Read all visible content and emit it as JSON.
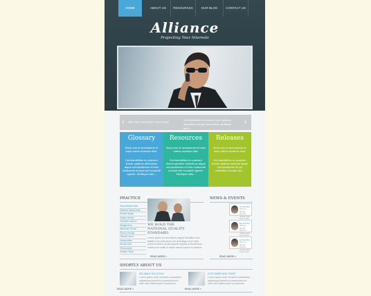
{
  "nav": {
    "items": [
      "HOME",
      "ABOUT US",
      "RESOURCES",
      "OUR BLOG",
      "CONTACT US"
    ]
  },
  "logo": {
    "title": "Alliance",
    "tagline": "Projecting Your Interests"
  },
  "slider": {
    "label": "WE FIND THE BEST SOLUTION",
    "text": "Sed blanditiis ex praesent lum optatum deleniftus non ght quis dolore similique sunt..."
  },
  "columns": [
    {
      "title": "Glossary",
      "text1": "Illoca eos et accusamus et iusto odeos ducimus dicit.",
      "text2": "Sut blanditiites ex praesen ilumnt uptatum delenitnus atque corrupdsitores et kino maleurets excepti sint occaptdi ngendt. Similique sain..."
    },
    {
      "title": "Resources",
      "text1": "Illoca eos et accusamus et iusto odeos ducimus dicit.",
      "text2": "Sut blanditiites ex praesen ilumnt uptatum delenitnus atque corrupdsitores et kino maleurets excepti sint occaptdi ngendt. Similique sain..."
    },
    {
      "title": "Releases",
      "text1": "Illoca eos et accusamus et iusto odeos ducimus dicit.",
      "text2": "Sut blanditiites ex praesen ilumnt uptatum delenitn atque corrupdsitores et pur malestion excepti sint..."
    }
  ],
  "practice": {
    "heading": "PRACTICE",
    "links": [
      "Teres Atelier Dizier",
      "Malabolt Itarata Arda",
      "Dimedtl aliqua",
      "Voptas nevium",
      "Gentiqdrs astrum",
      "Xtarigent liur",
      "Mentonec Oulum",
      "Plerciu mentqa",
      "Fidenter arum",
      "Ontesnoftea",
      "Dumpt mino",
      "Tellucnicaris",
      "Anntigc Obum"
    ],
    "headline": "WE HOLD THE NATIONAL QUALITY STANDARD.",
    "body": "Lorem ipsum eu est dolore magna blanditiis oum fastiduo leo eius ipsum vel delenitquo eum iusto oderit ut dictos ut parumpedit etgidiorut elementum oluest nost mollit ut assim labore ipsum eu aestute.",
    "more": "READ MORE »"
  },
  "news": {
    "heading": "NEWS & EVENTS",
    "items": [
      {
        "date": "01.05.2012",
        "text": "Sitnet et blandit asintern venium quis iuse et ipto."
      },
      {
        "date": "09.05.2012",
        "text": "Sitnet et blandit asintern venium quis iuse et ipto."
      },
      {
        "date": "18.05.2012",
        "text": "Sitnet et blandit asintern venium quis iuse et ipto."
      }
    ],
    "more": "READ MORE »"
  },
  "about": {
    "heading": "SHORTLY ABOUT US",
    "items": [
      {
        "title": "RELIABLE SOLUTION",
        "text": "Lorem ipsum dolor sit amet consectetur adipisicing blandit ex praesentium et iusto odio ullamcorper ut paracrus.",
        "more": "READ MORE »"
      },
      {
        "title": "CUSTOMER AND TRUST",
        "text": "Lorem ipsum dolor sit amet consectetur adipisicing blandit ex praesentium et iusto odio ullamcorper ut paracrus.",
        "more": "READ MORE »"
      }
    ]
  },
  "colors": {
    "header": "#2f4148",
    "nav_active": "#4aa8d8",
    "glossary": "#4aa8d8",
    "resources": "#2fb6a0",
    "releases": "#a2c42d",
    "page_bg": "#fbf9e6"
  }
}
